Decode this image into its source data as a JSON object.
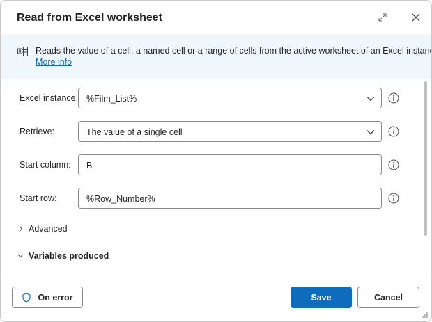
{
  "dialog": {
    "title": "Read from Excel worksheet"
  },
  "banner": {
    "description": "Reads the value of a cell, a named cell or a range of cells from the active worksheet of an Excel instance",
    "link": "More info",
    "icon": "excel-worksheet-icon"
  },
  "fields": {
    "excel_instance": {
      "label": "Excel instance:",
      "value": "%Film_List%"
    },
    "retrieve": {
      "label": "Retrieve:",
      "value": "The value of a single cell"
    },
    "start_column": {
      "label": "Start column:",
      "value": "B"
    },
    "start_row": {
      "label": "Start row:",
      "value": "%Row_Number%"
    }
  },
  "sections": {
    "advanced": "Advanced",
    "variables": "Variables produced"
  },
  "footer": {
    "on_error": "On error",
    "save": "Save",
    "cancel": "Cancel"
  },
  "colors": {
    "accent": "#0f6cbd",
    "banner_bg": "#eff6fc"
  }
}
